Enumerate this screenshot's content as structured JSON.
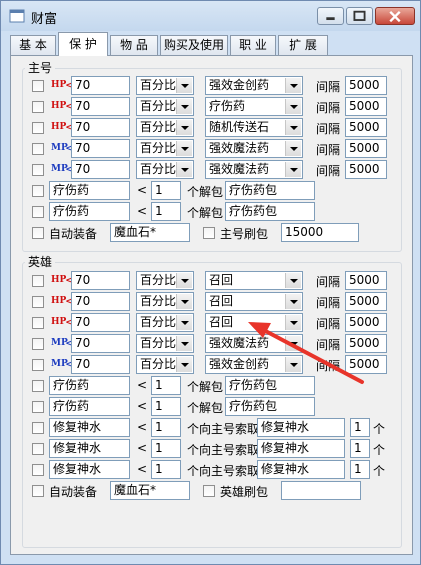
{
  "window": {
    "title": "财富"
  },
  "tabs": [
    "基 本",
    "保 护",
    "物 品",
    "购买及使用",
    "职 业",
    "扩 展"
  ],
  "active_tab": "保 护",
  "main": {
    "title": "主号",
    "threshold_rows": [
      {
        "type": "HP",
        "value": "70",
        "mode": "百分比",
        "item": "强效金创药",
        "interval_label": "间隔",
        "interval": "5000"
      },
      {
        "type": "HP",
        "value": "70",
        "mode": "百分比",
        "item": "疗伤药",
        "interval_label": "间隔",
        "interval": "5000"
      },
      {
        "type": "HP",
        "value": "70",
        "mode": "百分比",
        "item": "随机传送石",
        "interval_label": "间隔",
        "interval": "5000"
      },
      {
        "type": "MP",
        "value": "70",
        "mode": "百分比",
        "item": "强效魔法药",
        "interval_label": "间隔",
        "interval": "5000"
      },
      {
        "type": "MP",
        "value": "70",
        "mode": "百分比",
        "item": "强效魔法药",
        "interval_label": "间隔",
        "interval": "5000"
      }
    ],
    "unpack_rows": [
      {
        "item": "疗伤药",
        "lt": "<",
        "count": "1",
        "label": "个解包",
        "pack": "疗伤药包"
      },
      {
        "item": "疗伤药",
        "lt": "<",
        "count": "1",
        "label": "个解包",
        "pack": "疗伤药包"
      }
    ],
    "auto_equip": {
      "label": "自动装备",
      "value": "魔血石*"
    },
    "refresh": {
      "label": "主号刷包",
      "value": "15000"
    }
  },
  "hero": {
    "title": "英雄",
    "threshold_rows": [
      {
        "type": "HP",
        "value": "70",
        "mode": "百分比",
        "item": "召回",
        "interval_label": "间隔",
        "interval": "5000"
      },
      {
        "type": "HP",
        "value": "70",
        "mode": "百分比",
        "item": "召回",
        "interval_label": "间隔",
        "interval": "5000"
      },
      {
        "type": "HP",
        "value": "70",
        "mode": "百分比",
        "item": "召回",
        "interval_label": "间隔",
        "interval": "5000"
      },
      {
        "type": "MP",
        "value": "70",
        "mode": "百分比",
        "item": "强效魔法药",
        "interval_label": "间隔",
        "interval": "5000"
      },
      {
        "type": "MP",
        "value": "70",
        "mode": "百分比",
        "item": "强效金创药",
        "interval_label": "间隔",
        "interval": "5000"
      }
    ],
    "unpack_rows": [
      {
        "item": "疗伤药",
        "lt": "<",
        "count": "1",
        "label": "个解包",
        "pack": "疗伤药包"
      },
      {
        "item": "疗伤药",
        "lt": "<",
        "count": "1",
        "label": "个解包",
        "pack": "疗伤药包"
      }
    ],
    "request_rows": [
      {
        "item": "修复神水",
        "lt": "<",
        "count": "1",
        "label": "个向主号索取",
        "source": "修复神水",
        "amount": "1",
        "unit": "个"
      },
      {
        "item": "修复神水",
        "lt": "<",
        "count": "1",
        "label": "个向主号索取",
        "source": "修复神水",
        "amount": "1",
        "unit": "个"
      },
      {
        "item": "修复神水",
        "lt": "<",
        "count": "1",
        "label": "个向主号索取",
        "source": "修复神水",
        "amount": "1",
        "unit": "个"
      }
    ],
    "auto_equip": {
      "label": "自动装备",
      "value": "魔血石*"
    },
    "refresh": {
      "label": "英雄刷包",
      "value": ""
    }
  },
  "colors": {
    "hp": "#d01010",
    "mp": "#1c3bbf",
    "annotation_arrow": "#e8342a"
  }
}
